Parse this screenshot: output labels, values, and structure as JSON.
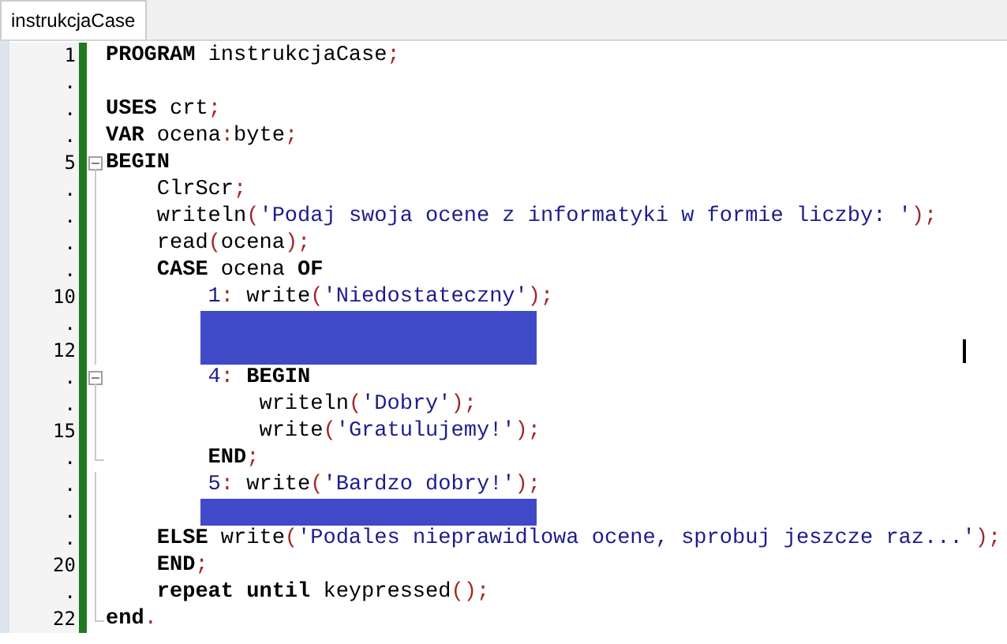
{
  "tabs": [
    {
      "label": "instrukcjaCase",
      "selected": true
    }
  ],
  "editor": {
    "lines": [
      {
        "number": "1",
        "selected": false,
        "tokens": [
          {
            "text": "PROGRAM",
            "kind": "kw"
          },
          {
            "text": " instrukcjaCase",
            "kind": "id"
          },
          {
            "text": ";",
            "kind": "sym"
          }
        ]
      },
      {
        "number": ".",
        "selected": false
      },
      {
        "number": ".",
        "selected": false,
        "tokens": [
          {
            "text": "USES",
            "kind": "kw"
          },
          {
            "text": " crt",
            "kind": "id"
          },
          {
            "text": ";",
            "kind": "sym"
          }
        ]
      },
      {
        "number": ".",
        "selected": false,
        "tokens": [
          {
            "text": "VAR",
            "kind": "kw"
          },
          {
            "text": " ocena",
            "kind": "id"
          },
          {
            "text": ":",
            "kind": "sym"
          },
          {
            "text": "byte",
            "kind": "id"
          },
          {
            "text": ";",
            "kind": "sym"
          }
        ]
      },
      {
        "number": "5",
        "selected": false,
        "expanded": true,
        "tokens": [
          {
            "text": "BEGIN",
            "kind": "kw"
          }
        ]
      },
      {
        "number": ".",
        "selected": false,
        "tokens": [
          {
            "text": "    ClrScr",
            "kind": "id"
          },
          {
            "text": ";",
            "kind": "sym"
          }
        ]
      },
      {
        "number": ".",
        "selected": false,
        "tokens": [
          {
            "text": "    writeln",
            "kind": "id"
          },
          {
            "text": "(",
            "kind": "sym"
          },
          {
            "text": "'Podaj swoja ocene z informatyki w formie liczby: '",
            "kind": "str"
          },
          {
            "text": ");",
            "kind": "sym"
          }
        ]
      },
      {
        "number": ".",
        "selected": false,
        "tokens": [
          {
            "text": "    read",
            "kind": "id"
          },
          {
            "text": "(",
            "kind": "sym"
          },
          {
            "text": "ocena",
            "kind": "id"
          },
          {
            "text": ");",
            "kind": "sym"
          }
        ]
      },
      {
        "number": ".",
        "selected": false,
        "tokens": [
          {
            "text": "    CASE",
            "kind": "kw"
          },
          {
            "text": " ocena ",
            "kind": "id"
          },
          {
            "text": "OF",
            "kind": "kw"
          }
        ]
      },
      {
        "number": "10",
        "selected": false,
        "tokens": [
          {
            "text": "        1",
            "kind": "num"
          },
          {
            "text": ":",
            "kind": "sym"
          },
          {
            "text": " write",
            "kind": "id"
          },
          {
            "text": "(",
            "kind": "sym"
          },
          {
            "text": "'Niedostateczny'",
            "kind": "str"
          },
          {
            "text": ");",
            "kind": "sym"
          }
        ]
      },
      {
        "number": ".",
        "selected": true
      },
      {
        "number": "12",
        "selected": true,
        "cursor": true
      },
      {
        "number": ".",
        "selected": false,
        "expanded": true,
        "tokens": [
          {
            "text": "        4",
            "kind": "num"
          },
          {
            "text": ":",
            "kind": "sym"
          },
          {
            "text": " BEGIN",
            "kind": "kw"
          }
        ]
      },
      {
        "number": ".",
        "selected": false,
        "tokens": [
          {
            "text": "            writeln",
            "kind": "id"
          },
          {
            "text": "(",
            "kind": "sym"
          },
          {
            "text": "'Dobry'",
            "kind": "str"
          },
          {
            "text": ");",
            "kind": "sym"
          }
        ]
      },
      {
        "number": "15",
        "selected": false,
        "tokens": [
          {
            "text": "            write",
            "kind": "id"
          },
          {
            "text": "(",
            "kind": "sym"
          },
          {
            "text": "'Gratulujemy!'",
            "kind": "str"
          },
          {
            "text": ");",
            "kind": "sym"
          }
        ]
      },
      {
        "number": ".",
        "selected": false,
        "fold_end": true,
        "tokens": [
          {
            "text": "        END",
            "kind": "kw"
          },
          {
            "text": ";",
            "kind": "sym"
          }
        ]
      },
      {
        "number": ".",
        "selected": false,
        "tokens": [
          {
            "text": "        5",
            "kind": "num"
          },
          {
            "text": ":",
            "kind": "sym"
          },
          {
            "text": " write",
            "kind": "id"
          },
          {
            "text": "(",
            "kind": "sym"
          },
          {
            "text": "'Bardzo dobry!'",
            "kind": "str"
          },
          {
            "text": ");",
            "kind": "sym"
          }
        ]
      },
      {
        "number": ".",
        "selected": true
      },
      {
        "number": ".",
        "selected": false,
        "tokens": [
          {
            "text": "    ELSE",
            "kind": "kw"
          },
          {
            "text": " write",
            "kind": "id"
          },
          {
            "text": "(",
            "kind": "sym"
          },
          {
            "text": "'Podales nieprawidlowa ocene, sprobuj jeszcze raz...'",
            "kind": "str"
          },
          {
            "text": ");",
            "kind": "sym"
          }
        ]
      },
      {
        "number": "20",
        "selected": false,
        "tokens": [
          {
            "text": "    END",
            "kind": "kw"
          },
          {
            "text": ";",
            "kind": "sym"
          }
        ]
      },
      {
        "number": ".",
        "selected": false,
        "tokens": [
          {
            "text": "    repeat until",
            "kind": "kw"
          },
          {
            "text": " keypressed",
            "kind": "id"
          },
          {
            "text": "();",
            "kind": "sym"
          }
        ]
      },
      {
        "number": "22",
        "selected": false,
        "fold_end": true,
        "tokens": [
          {
            "text": "end",
            "kind": "kw"
          },
          {
            "text": ".",
            "kind": "sym"
          }
        ]
      }
    ]
  }
}
